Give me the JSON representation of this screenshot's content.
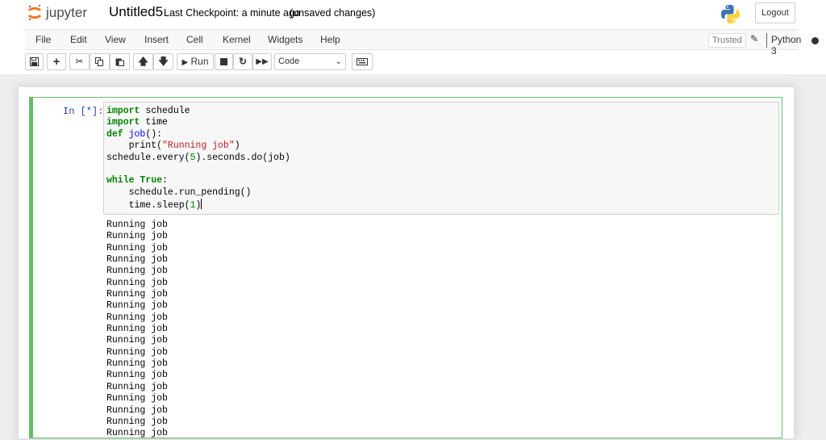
{
  "header": {
    "brand": "jupyter",
    "notebook_title": "Untitled5",
    "checkpoint": "Last Checkpoint: a minute ago",
    "autosave_status": "(unsaved changes)",
    "logout_label": "Logout"
  },
  "menubar": {
    "items": [
      "File",
      "Edit",
      "View",
      "Insert",
      "Cell",
      "Kernel",
      "Widgets",
      "Help"
    ],
    "trusted_label": "Trusted",
    "kernel_name": "Python 3"
  },
  "toolbar": {
    "run_label": "Run",
    "cell_type": "Code",
    "buttons": [
      "save-icon",
      "plus-icon",
      "scissors-icon",
      "copy-icon",
      "paste-icon",
      "arrow-up-icon",
      "arrow-down-icon",
      "run-icon",
      "stop-icon",
      "restart-icon",
      "fast-forward-icon",
      "keyboard-icon"
    ]
  },
  "cell": {
    "prompt": "In [*]:",
    "code_lines": [
      "import schedule",
      "import time",
      "def job():",
      "    print(\"Running job\")",
      "schedule.every(5).seconds.do(job)",
      "",
      "while True:",
      "    schedule.run_pending()",
      "    time.sleep(1)"
    ],
    "output_lines": [
      "Running job",
      "Running job",
      "Running job",
      "Running job",
      "Running job",
      "Running job",
      "Running job",
      "Running job",
      "Running job",
      "Running job",
      "Running job",
      "Running job",
      "Running job",
      "Running job",
      "Running job",
      "Running job",
      "Running job",
      "Running job",
      "Running job"
    ]
  },
  "colors": {
    "cell_border_active": "#66bb6a",
    "prompt_color": "#303f9f",
    "keyword": "#008000",
    "string": "#ba2121",
    "function": "#0000ff",
    "jupyter_orange": "#f37726"
  }
}
